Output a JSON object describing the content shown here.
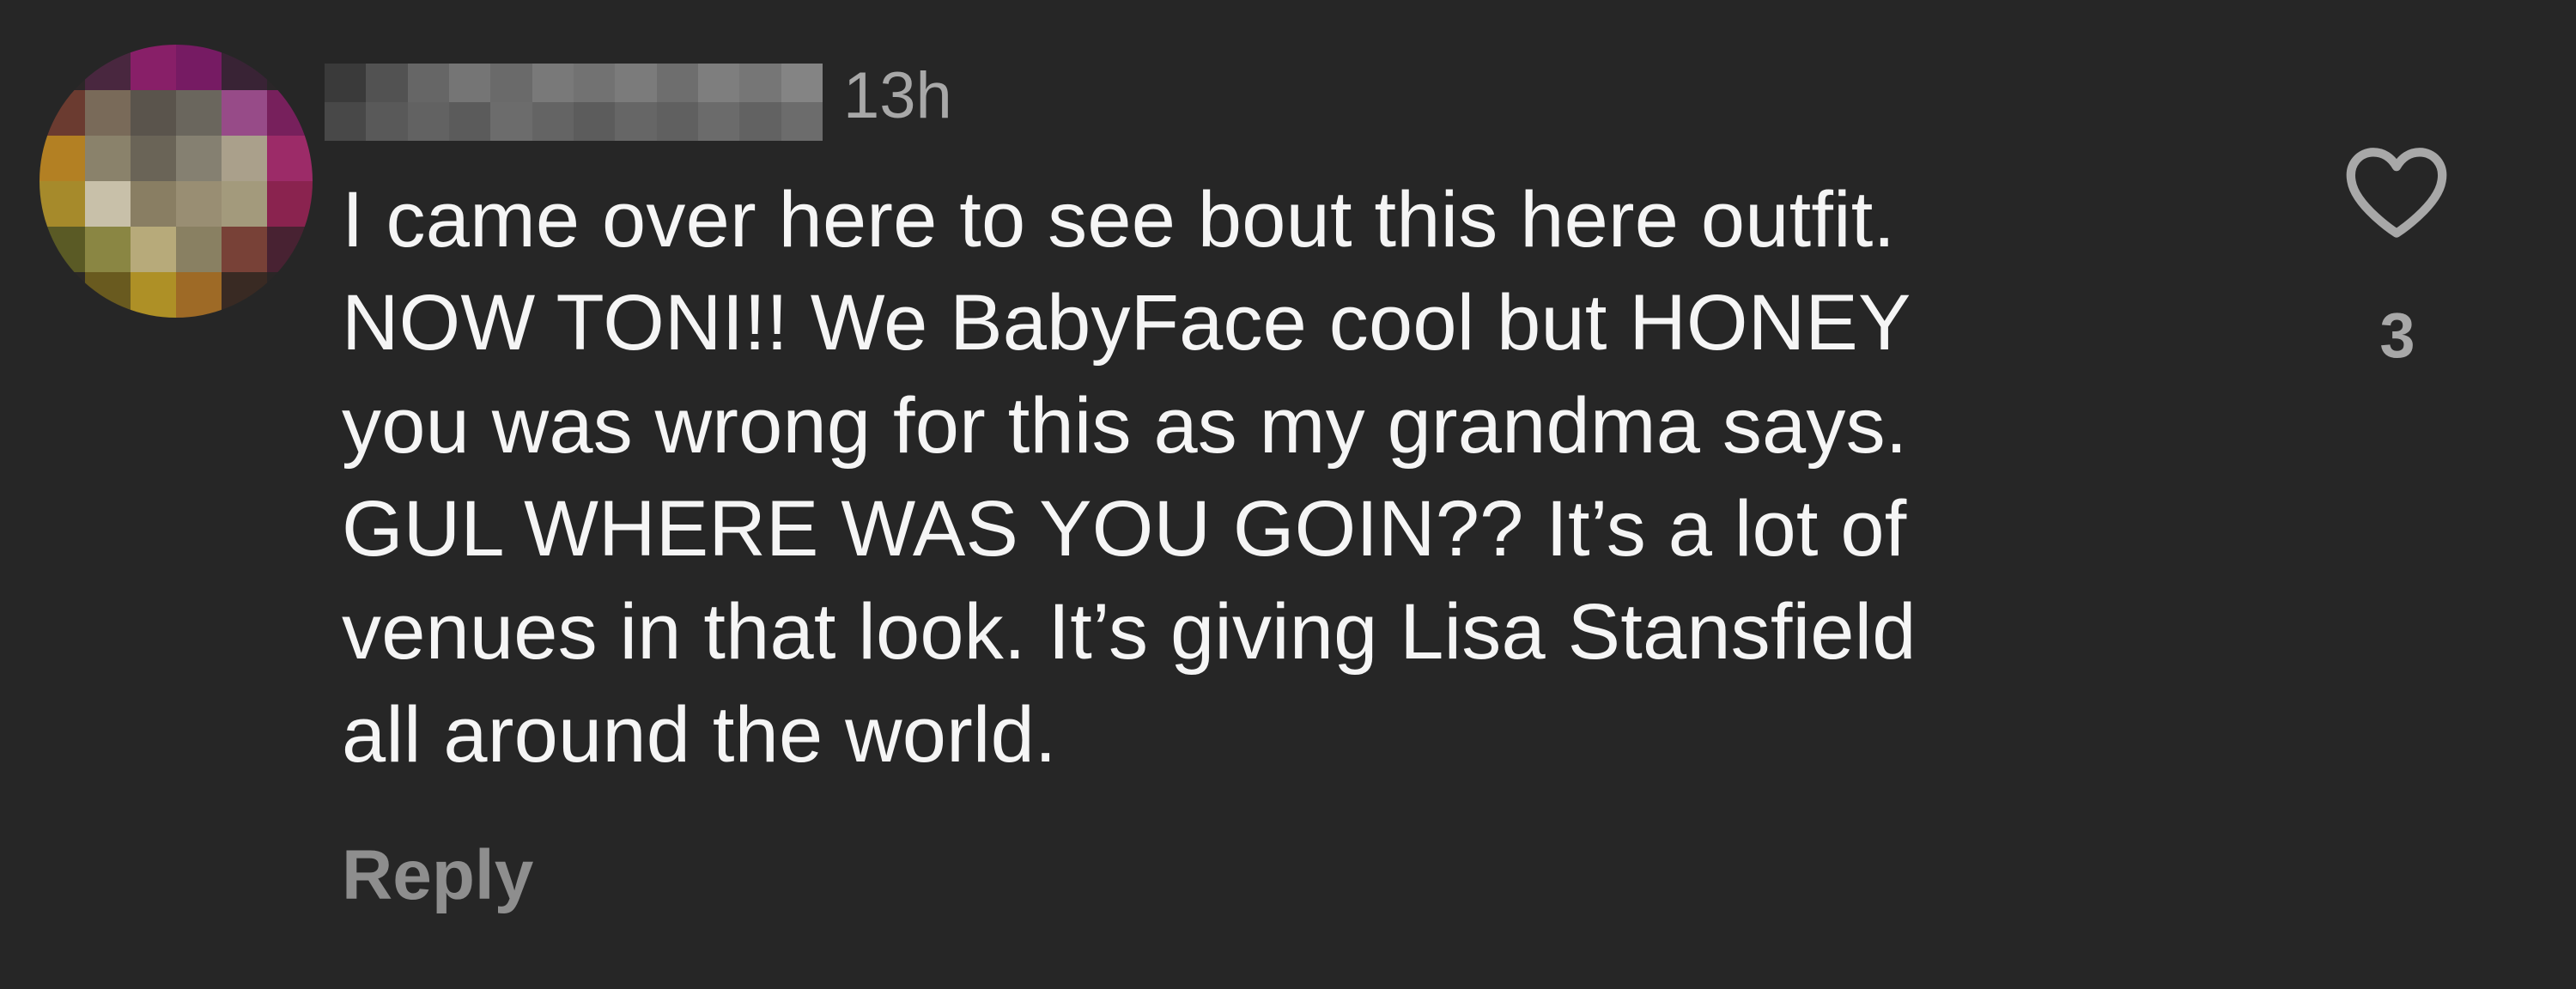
{
  "comment": {
    "timestamp": "13h",
    "body_lines": [
      "I came over here to see bout this here outfit.",
      "NOW TONI!! We BabyFace cool but HONEY",
      "you was wrong for this as my grandma says.",
      "GUL WHERE WAS YOU GOIN?? It’s a lot of",
      "venues in that look. It’s giving Lisa Stansfield",
      "all around the world."
    ],
    "reply_label": "Reply",
    "like_count": "3",
    "icons": {
      "like": "heart-outline-icon"
    }
  },
  "colors": {
    "background": "#262626",
    "text_primary": "#f5f5f5",
    "text_secondary": "#a8a8a8",
    "reply": "#8e8e8e"
  }
}
